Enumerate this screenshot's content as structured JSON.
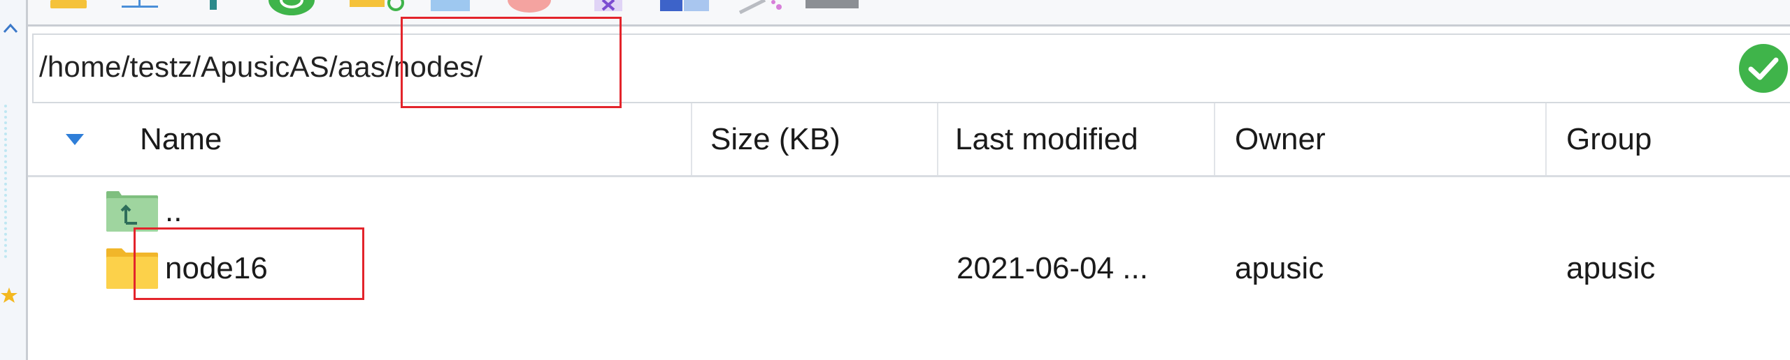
{
  "toolbar": {
    "buttons": [
      {
        "name": "folder-icon",
        "color": "#f5c23a"
      },
      {
        "name": "upload-icon",
        "color": "#4a8fd8"
      },
      {
        "name": "pin-icon",
        "color": "#2d8a8a"
      },
      {
        "name": "refresh-icon",
        "color": "#3fb44a"
      },
      {
        "name": "folder-sync-icon",
        "color": "#f5c23a"
      },
      {
        "name": "blue-square-icon",
        "color": "#9ec8f0"
      },
      {
        "name": "red-circle-icon",
        "color": "#f4a3a0"
      },
      {
        "name": "text-edit-icon",
        "color": "#7b4bd1"
      },
      {
        "name": "split-view-icon",
        "color": "#3d63c9"
      },
      {
        "name": "magic-wand-icon",
        "color": "#d77fd9"
      },
      {
        "name": "gray-bar-icon",
        "color": "#8c8f94"
      }
    ]
  },
  "path_bar": {
    "value": "/home/testz/ApusicAS/aas/nodes/",
    "status_icon": "check-circle-icon",
    "status_color": "#3fb44a"
  },
  "table": {
    "sort_icon": "sort-down-triangle-icon",
    "columns": [
      {
        "key": "name",
        "label": "Name"
      },
      {
        "key": "size",
        "label": "Size (KB)"
      },
      {
        "key": "modified",
        "label": "Last modified"
      },
      {
        "key": "owner",
        "label": "Owner"
      },
      {
        "key": "group",
        "label": "Group"
      }
    ],
    "rows": [
      {
        "icon": "parent-folder-icon",
        "name": "..",
        "size": "",
        "modified": "",
        "owner": "",
        "group": ""
      },
      {
        "icon": "folder-icon",
        "name": "node16",
        "size": "",
        "modified": "2021-06-04 ...",
        "owner": "apusic",
        "group": "apusic"
      }
    ]
  },
  "annotation_color": "#e3242b"
}
